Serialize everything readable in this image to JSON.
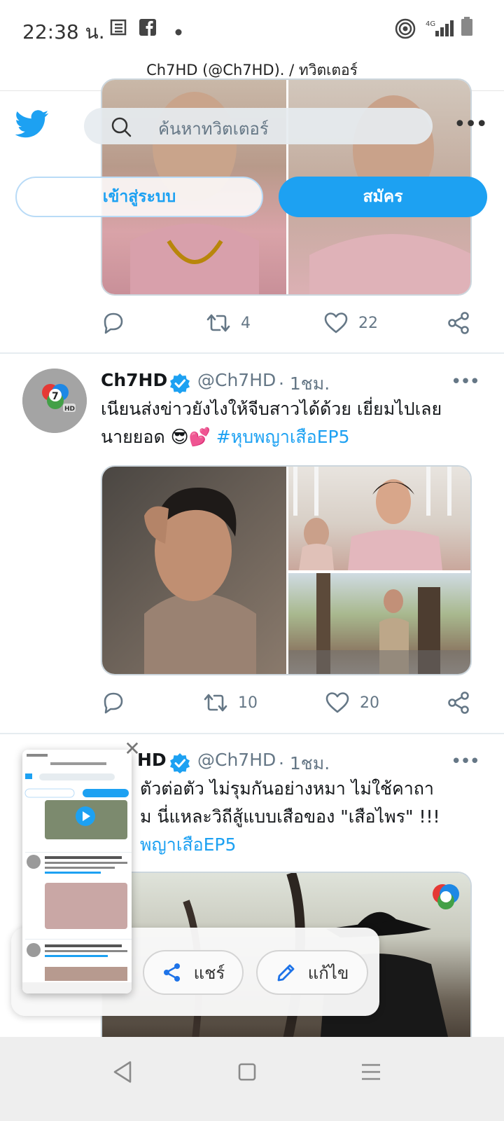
{
  "status_bar": {
    "time": "22:38 น.",
    "network": "4G"
  },
  "browser": {
    "page_title": "Ch7HD (@Ch7HD). / ทวิตเตอร์"
  },
  "header": {
    "search_placeholder": "ค้นหาทวิตเตอร์",
    "login_label": "เข้าสู่ระบบ",
    "signup_label": "สมัคร"
  },
  "colors": {
    "accent": "#1da1f2",
    "text": "#14171a",
    "muted": "#657786"
  },
  "tweets": [
    {
      "actions": {
        "retweets": "4",
        "likes": "22"
      }
    },
    {
      "name": "Ch7HD",
      "handle": "@Ch7HD",
      "time": "· 1ชม.",
      "text_line1": "เนียนส่งข่าวยังไงให้จีบสาวได้ด้วย เยี่ยมไปเลย",
      "text_line2": "นายยอด 😎💕",
      "hashtag": "#หุบพญาเสือEP5",
      "actions": {
        "retweets": "10",
        "likes": "20"
      }
    },
    {
      "name": "HD",
      "handle": "@Ch7HD",
      "time": "· 1ชม.",
      "text_line1": "ตัวต่อตัว ไม่รุมกันอย่างหมา ไม่ใช้คาถา",
      "text_line2": "ม นี่แหละวิถีสู้แบบเสือของ \"เสือไพร\" !!!",
      "hashtag": "พญาเสือEP5"
    }
  ],
  "screenshot_overlay": {
    "share_label": "แชร์",
    "edit_label": "แก้ไข"
  }
}
